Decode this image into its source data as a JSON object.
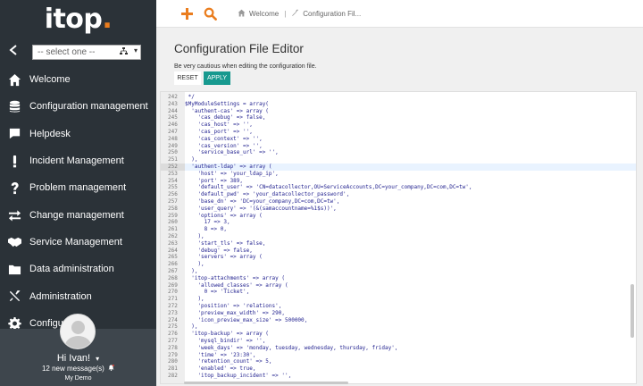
{
  "app": {
    "logo_text": "itop",
    "logo_dot": "."
  },
  "sidebar": {
    "org_select": {
      "value": "-- select one --"
    },
    "items": [
      {
        "label": "Welcome",
        "icon": "house-icon"
      },
      {
        "label": "Configuration management",
        "icon": "database-icon"
      },
      {
        "label": "Helpdesk",
        "icon": "chat-icon"
      },
      {
        "label": "Incident Management",
        "icon": "exclamation-icon"
      },
      {
        "label": "Problem management",
        "icon": "question-icon"
      },
      {
        "label": "Change management",
        "icon": "arrows-icon"
      },
      {
        "label": "Service Management",
        "icon": "handshake-icon"
      },
      {
        "label": "Data administration",
        "icon": "folder-icon"
      },
      {
        "label": "Administration",
        "icon": "tools-icon"
      },
      {
        "label": "Configuration",
        "icon": "gear-icon"
      }
    ]
  },
  "user": {
    "name": "Hi Ivan!",
    "messages": "12 new message(s)",
    "organization": "My Demo"
  },
  "breadcrumb": {
    "items": [
      {
        "label": "Welcome"
      },
      {
        "label": "Configuration Fil..."
      }
    ]
  },
  "page": {
    "title": "Configuration File Editor",
    "warning": "Be very cautious when editing the configuration file.",
    "reset_label": "RESET",
    "apply_label": "APPLY"
  },
  "editor": {
    "lines": [
      {
        "n": "242",
        "t": " */"
      },
      {
        "n": "243",
        "t": "$MyModuleSettings = array("
      },
      {
        "n": "244",
        "t": "  'authent-cas' => array ("
      },
      {
        "n": "245",
        "t": "    'cas_debug' => false,"
      },
      {
        "n": "246",
        "t": "    'cas_host' => '',"
      },
      {
        "n": "247",
        "t": "    'cas_port' => '',"
      },
      {
        "n": "248",
        "t": "    'cas_context' => '',"
      },
      {
        "n": "249",
        "t": "    'cas_version' => '',"
      },
      {
        "n": "250",
        "t": "    'service_base_url' => '',"
      },
      {
        "n": "251",
        "t": "  ),"
      },
      {
        "n": "252",
        "t": "  'authent-ldap' => array (",
        "active": true
      },
      {
        "n": "253",
        "t": "    'host' => 'your_ldap_ip',"
      },
      {
        "n": "254",
        "t": "    'port' => 389,"
      },
      {
        "n": "255",
        "t": "    'default_user' => 'CN=datacollector,OU=ServiceAccounts,DC=your_company,DC=com,DC=tw',"
      },
      {
        "n": "256",
        "t": "    'default_pwd' => 'your_datacollector_password',"
      },
      {
        "n": "257",
        "t": "    'base_dn' => 'DC=your_company,DC=com,DC=tw',"
      },
      {
        "n": "258",
        "t": "    'user_query' => '(&(samaccountname=%1$s))',"
      },
      {
        "n": "259",
        "t": "    'options' => array ("
      },
      {
        "n": "260",
        "t": "      17 => 3,"
      },
      {
        "n": "261",
        "t": "      8 => 0,"
      },
      {
        "n": "262",
        "t": "    ),"
      },
      {
        "n": "263",
        "t": "    'start_tls' => false,"
      },
      {
        "n": "264",
        "t": "    'debug' => false,"
      },
      {
        "n": "265",
        "t": "    'servers' => array ("
      },
      {
        "n": "266",
        "t": "    ),"
      },
      {
        "n": "267",
        "t": "  ),"
      },
      {
        "n": "268",
        "t": "  'itop-attachments' => array ("
      },
      {
        "n": "269",
        "t": "    'allowed_classes' => array ("
      },
      {
        "n": "270",
        "t": "      0 => 'Ticket',"
      },
      {
        "n": "271",
        "t": "    ),"
      },
      {
        "n": "272",
        "t": "    'position' => 'relations',"
      },
      {
        "n": "273",
        "t": "    'preview_max_width' => 290,"
      },
      {
        "n": "274",
        "t": "    'icon_preview_max_size' => 500000,"
      },
      {
        "n": "275",
        "t": "  ),"
      },
      {
        "n": "276",
        "t": "  'itop-backup' => array ("
      },
      {
        "n": "277",
        "t": "    'mysql_bindir' => '',"
      },
      {
        "n": "278",
        "t": "    'week_days' => 'monday, tuesday, wednesday, thursday, friday',"
      },
      {
        "n": "279",
        "t": "    'time' => '23:30',"
      },
      {
        "n": "280",
        "t": "    'retention_count' => 5,"
      },
      {
        "n": "281",
        "t": "    'enabled' => true,"
      },
      {
        "n": "282",
        "t": "    'itop_backup_incident' => '',"
      }
    ]
  },
  "colors": {
    "sidebar_bg": "#2b3238",
    "accent_orange": "#ea7d1e",
    "apply_teal": "#17998f"
  }
}
